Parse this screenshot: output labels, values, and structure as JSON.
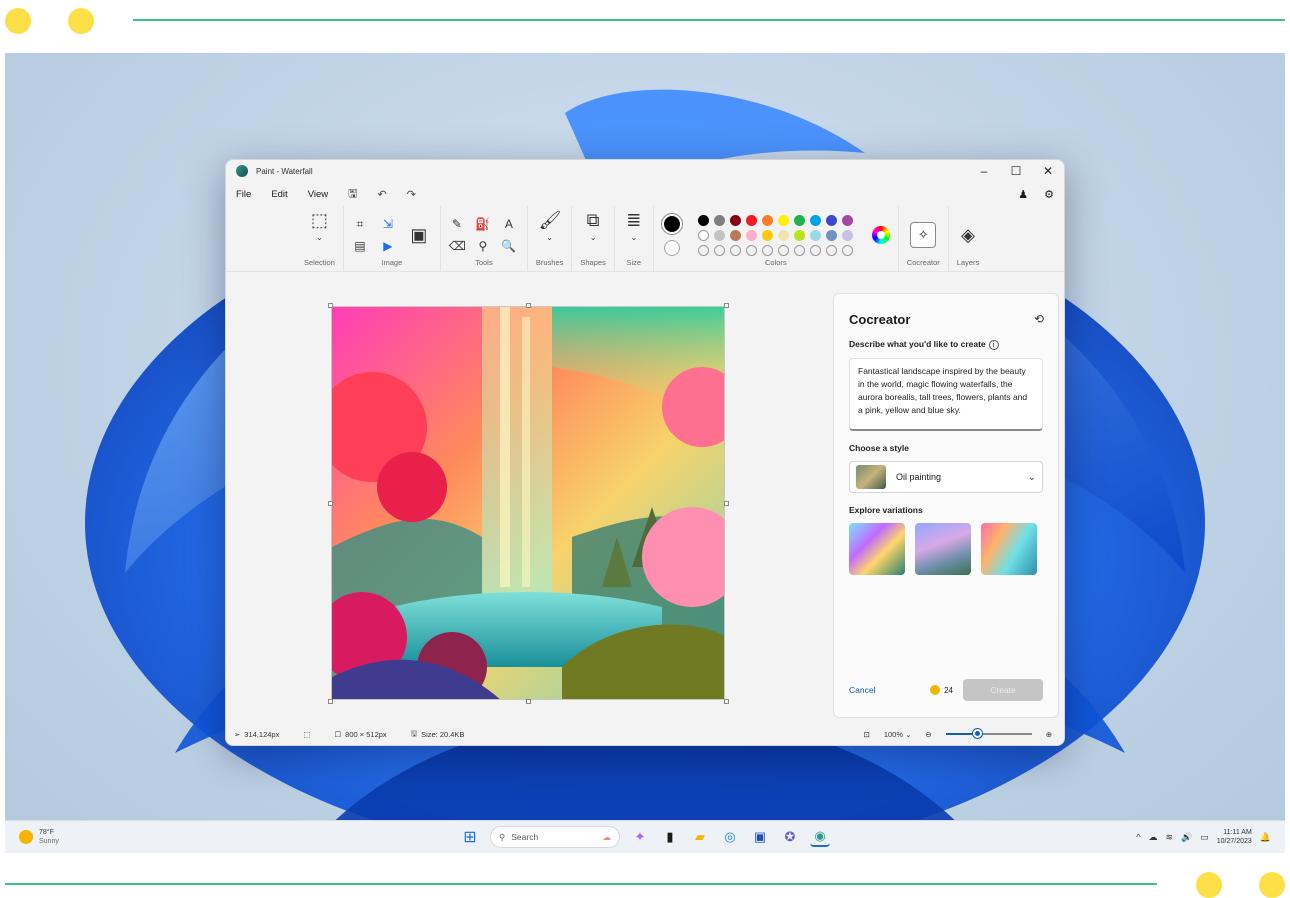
{
  "window": {
    "title": "Paint - Waterfall"
  },
  "menu": {
    "file": "File",
    "edit": "Edit",
    "view": "View"
  },
  "ribbon": {
    "groups": {
      "selection": "Selection",
      "image": "Image",
      "tools": "Tools",
      "brushes": "Brushes",
      "shapes": "Shapes",
      "size": "Size",
      "colors": "Colors",
      "cocreator": "Cocreator",
      "layers": "Layers"
    },
    "palette_row1": [
      "#000000",
      "#7f7f7f",
      "#880015",
      "#ed1c24",
      "#ff7f27",
      "#fff200",
      "#22b14c",
      "#00a2e8",
      "#3f48cc",
      "#a349a4"
    ],
    "palette_row2": [
      "#ffffff",
      "#c3c3c3",
      "#b97a57",
      "#ffaec9",
      "#ffc90e",
      "#efe4b0",
      "#b5e61d",
      "#99d9ea",
      "#7092be",
      "#c8bfe7"
    ]
  },
  "panel": {
    "title": "Cocreator",
    "prompt_label": "Describe what you'd like to create",
    "prompt_text": "Fantastical landscape inspired by the beauty in the world, magic flowing waterfalls, the aurora borealis, tall trees, flowers, plants and a pink, yellow and blue sky.",
    "style_label": "Choose a style",
    "style_value": "Oil painting",
    "variations_label": "Explore variations",
    "cancel": "Cancel",
    "credits": "24",
    "create": "Create"
  },
  "status": {
    "cursor": "314,124px",
    "canvas_size": "800 × 512px",
    "file_size": "Size: 20.4KB",
    "zoom": "100%",
    "zoom_fraction": 0.38
  },
  "taskbar": {
    "temp": "78°F",
    "condition": "Sunny",
    "search": "Search",
    "time": "11:11 AM",
    "date": "10/27/2023"
  }
}
